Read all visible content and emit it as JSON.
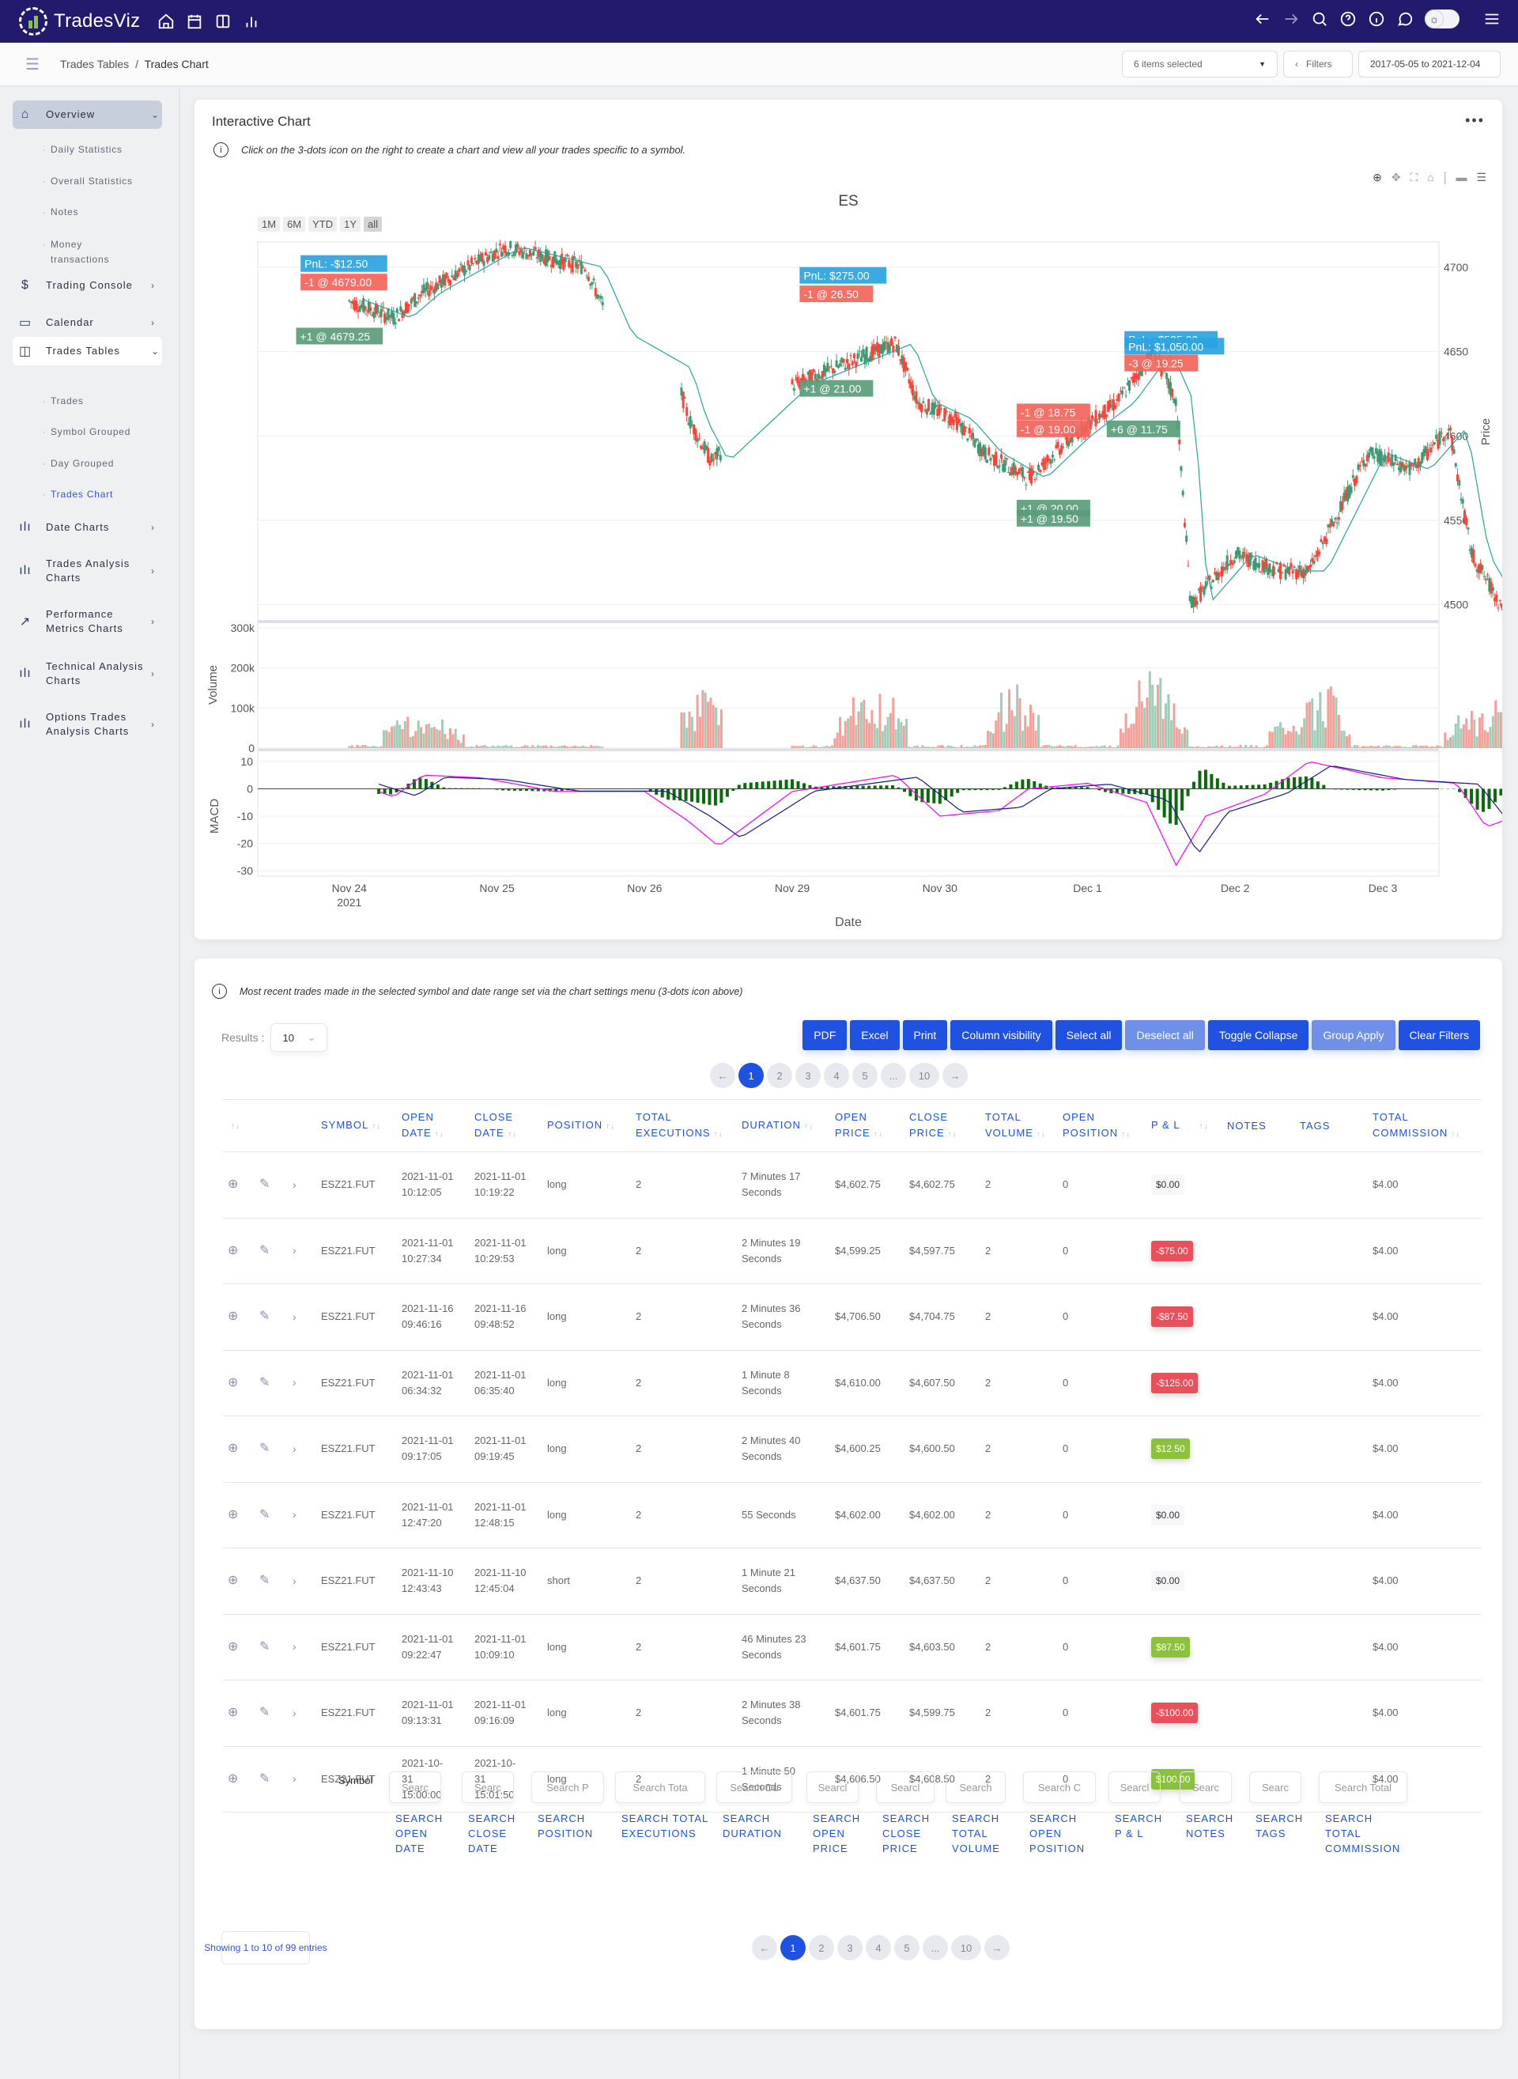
{
  "app": {
    "brand": "TradesViz"
  },
  "topbar": {
    "left_icons": [
      "home-icon",
      "calendar-icon",
      "columns-icon",
      "bar-chart-icon"
    ],
    "right_icons": [
      "back-arrow-icon",
      "forward-arrow-icon",
      "search-icon",
      "help-icon",
      "info-icon",
      "chat-icon"
    ],
    "theme_toggle": "sun-icon"
  },
  "subbar": {
    "breadcrumb_parent": "Trades Tables",
    "breadcrumb_sep": "/",
    "breadcrumb_current": "Trades Chart",
    "items_selected": "6 items selected",
    "filters": "Filters",
    "date_range": "2017-05-05 to 2021-12-04"
  },
  "sidebar": {
    "items": [
      {
        "label": "Overview",
        "icon": "home-icon"
      },
      {
        "label": "Trading Console",
        "icon": "dollar-icon"
      },
      {
        "label": "Calendar",
        "icon": "calendar-icon"
      },
      {
        "label": "Trades Tables",
        "icon": "columns-icon"
      },
      {
        "label": "Date Charts",
        "icon": "bar-chart-icon"
      },
      {
        "label": "Trades Analysis Charts",
        "icon": "bar-chart-icon"
      },
      {
        "label": "Performance Metrics Charts",
        "icon": "trend-icon"
      },
      {
        "label": "Technical Analysis Charts",
        "icon": "bar-chart-icon"
      },
      {
        "label": "Options Trades Analysis Charts",
        "icon": "bar-chart-icon"
      }
    ],
    "overview_sub": [
      "Daily Statistics",
      "Overall Statistics",
      "Notes",
      "Money transactions"
    ],
    "tables_sub": [
      "Trades",
      "Symbol Grouped",
      "Day Grouped",
      "Trades Chart"
    ]
  },
  "chart_card": {
    "title": "Interactive Chart",
    "info": "Click on the 3-dots icon on the right to create a chart and view all your trades specific to a symbol.",
    "range_buttons": [
      "1M",
      "6M",
      "YTD",
      "1Y",
      "all"
    ],
    "selected_range": "all",
    "modebar": [
      "zoom-icon",
      "pan-icon",
      "autoscale-icon",
      "reset-icon",
      "spike-icon",
      "hover-closest-icon",
      "hover-compare-icon"
    ]
  },
  "chart_data": {
    "type": "candlestick",
    "title": "ES",
    "xlabel": "Date",
    "x_ticks": [
      "Nov 24\n2021",
      "Nov 25",
      "Nov 26",
      "Nov 29",
      "Nov 30",
      "Dec 1",
      "Dec 2",
      "Dec 3"
    ],
    "price_panel": {
      "ylabel": "Price",
      "ylim": [
        4490,
        4715
      ],
      "y_ticks": [
        4500,
        4550,
        4600,
        4650,
        4700
      ],
      "trend_approx": [
        [
          0,
          4680
        ],
        [
          0.3,
          4670
        ],
        [
          0.5,
          4685
        ],
        [
          1.05,
          4712
        ],
        [
          1.6,
          4700
        ],
        [
          1.8,
          4660
        ],
        [
          2.2,
          4640
        ],
        [
          2.3,
          4610
        ],
        [
          2.45,
          4585
        ],
        [
          3.0,
          4630
        ],
        [
          3.7,
          4655
        ],
        [
          3.85,
          4620
        ],
        [
          4.1,
          4610
        ],
        [
          4.3,
          4590
        ],
        [
          4.6,
          4575
        ],
        [
          4.9,
          4600
        ],
        [
          5.2,
          4620
        ],
        [
          5.45,
          4650
        ],
        [
          5.6,
          4620
        ],
        [
          5.7,
          4500
        ],
        [
          6.0,
          4530
        ],
        [
          6.3,
          4520
        ],
        [
          6.5,
          4520
        ],
        [
          6.9,
          4590
        ],
        [
          7.2,
          4580
        ],
        [
          7.45,
          4605
        ],
        [
          7.6,
          4530
        ],
        [
          7.8,
          4500
        ],
        [
          8.0,
          4530
        ]
      ],
      "annotations": [
        {
          "label": "PnL: -$12.50",
          "kind": "pnl"
        },
        {
          "label": "-1 @ 4679.00",
          "kind": "sell"
        },
        {
          "label": "+1 @ 4679.25",
          "kind": "buy"
        },
        {
          "label": "PnL: $275.00",
          "kind": "pnl"
        },
        {
          "label": "-1 @ 26.50",
          "kind": "sell"
        },
        {
          "label": "+1 @ 21.00",
          "kind": "buy"
        },
        {
          "label": "PnL: -$525.00",
          "kind": "pnl"
        },
        {
          "label": "PnL: $1,050.00",
          "kind": "pnl"
        },
        {
          "label": "-3 @ 19.25",
          "kind": "sell"
        },
        {
          "label": "+6 @ 11.75",
          "kind": "buy"
        },
        {
          "label": "-1 @ 18.75",
          "kind": "sell"
        },
        {
          "label": "-1 @ 19.00",
          "kind": "sell"
        },
        {
          "label": "+1 @ 20.00",
          "kind": "buy"
        },
        {
          "label": "+1 @ 19.50",
          "kind": "buy"
        }
      ]
    },
    "volume_panel": {
      "ylabel": "Volume",
      "ylim": [
        0,
        300000
      ],
      "y_ticks": [
        "0",
        "100k",
        "200k",
        "300k"
      ],
      "spikes_approx": [
        [
          0.4,
          105000
        ],
        [
          0.6,
          87000
        ],
        [
          2.4,
          165000
        ],
        [
          3.45,
          145000
        ],
        [
          3.6,
          170000
        ],
        [
          4.5,
          190000
        ],
        [
          5.4,
          210000
        ],
        [
          5.5,
          200000
        ],
        [
          6.4,
          100000
        ],
        [
          6.6,
          180000
        ],
        [
          7.6,
          120000
        ],
        [
          7.85,
          175000
        ]
      ]
    },
    "macd_panel": {
      "ylabel": "MACD",
      "ylim": [
        -32,
        12
      ],
      "y_ticks": [
        10,
        0,
        -10,
        -20,
        -30
      ],
      "macd_approx": [
        [
          0.2,
          -1
        ],
        [
          0.3,
          -3
        ],
        [
          0.5,
          5
        ],
        [
          0.9,
          4
        ],
        [
          1.4,
          -1
        ],
        [
          2.0,
          -1
        ],
        [
          2.3,
          -12
        ],
        [
          2.5,
          -21
        ],
        [
          3.0,
          -1
        ],
        [
          3.7,
          5
        ],
        [
          4.0,
          -10
        ],
        [
          4.4,
          -8
        ],
        [
          4.6,
          0
        ],
        [
          5.0,
          2
        ],
        [
          5.4,
          -5
        ],
        [
          5.6,
          -28
        ],
        [
          5.8,
          -10
        ],
        [
          6.2,
          -2
        ],
        [
          6.5,
          10
        ],
        [
          7.0,
          4
        ],
        [
          7.5,
          2
        ],
        [
          7.7,
          -14
        ],
        [
          8.0,
          -8
        ]
      ]
    }
  },
  "trades_card": {
    "info": "Most recent trades made in the selected symbol and date range set via the chart settings menu (3-dots icon above)",
    "results_label": "Results :",
    "results_value": "10",
    "buttons": [
      {
        "label": "PDF",
        "dim": false
      },
      {
        "label": "Excel",
        "dim": false
      },
      {
        "label": "Print",
        "dim": false
      },
      {
        "label": "Column visibility",
        "dim": false
      },
      {
        "label": "Select all",
        "dim": false
      },
      {
        "label": "Deselect all",
        "dim": true
      },
      {
        "label": "Toggle Collapse",
        "dim": false
      },
      {
        "label": "Group Apply",
        "dim": true
      },
      {
        "label": "Clear Filters",
        "dim": false
      }
    ],
    "pages": [
      "←",
      "1",
      "2",
      "3",
      "4",
      "5",
      "...",
      "10",
      "→"
    ],
    "current_page": "1",
    "columns": [
      "SYMBOL",
      "OPEN DATE",
      "CLOSE DATE",
      "POSITION",
      "TOTAL EXECUTIONS",
      "DURATION",
      "OPEN PRICE",
      "CLOSE PRICE",
      "TOTAL VOLUME",
      "OPEN POSITION",
      "P & L",
      "NOTES",
      "TAGS",
      "TOTAL COMMISSION"
    ],
    "rows": [
      {
        "symbol": "ESZ21.FUT",
        "open": "2021-11-01 10:12:05",
        "close": "2021-11-01 10:19:22",
        "position": "long",
        "execs": "2",
        "duration": "7 Minutes 17 Seconds",
        "open_price": "$4,602.75",
        "close_price": "$4,602.75",
        "volume": "2",
        "open_pos": "0",
        "pnl": "$0.00",
        "pnl_kind": "zero",
        "notes": "",
        "tags": "",
        "commission": "$4.00"
      },
      {
        "symbol": "ESZ21.FUT",
        "open": "2021-11-01 10:27:34",
        "close": "2021-11-01 10:29:53",
        "position": "long",
        "execs": "2",
        "duration": "2 Minutes 19 Seconds",
        "open_price": "$4,599.25",
        "close_price": "$4,597.75",
        "volume": "2",
        "open_pos": "0",
        "pnl": "-$75.00",
        "pnl_kind": "neg",
        "notes": "",
        "tags": "",
        "commission": "$4.00"
      },
      {
        "symbol": "ESZ21.FUT",
        "open": "2021-11-16 09:46:16",
        "close": "2021-11-16 09:48:52",
        "position": "long",
        "execs": "2",
        "duration": "2 Minutes 36 Seconds",
        "open_price": "$4,706.50",
        "close_price": "$4,704.75",
        "volume": "2",
        "open_pos": "0",
        "pnl": "-$87.50",
        "pnl_kind": "neg",
        "notes": "",
        "tags": "",
        "commission": "$4.00"
      },
      {
        "symbol": "ESZ21.FUT",
        "open": "2021-11-01 06:34:32",
        "close": "2021-11-01 06:35:40",
        "position": "long",
        "execs": "2",
        "duration": "1 Minute 8 Seconds",
        "open_price": "$4,610.00",
        "close_price": "$4,607.50",
        "volume": "2",
        "open_pos": "0",
        "pnl": "-$125.00",
        "pnl_kind": "neg",
        "notes": "",
        "tags": "",
        "commission": "$4.00"
      },
      {
        "symbol": "ESZ21.FUT",
        "open": "2021-11-01 09:17:05",
        "close": "2021-11-01 09:19:45",
        "position": "long",
        "execs": "2",
        "duration": "2 Minutes 40 Seconds",
        "open_price": "$4,600.25",
        "close_price": "$4,600.50",
        "volume": "2",
        "open_pos": "0",
        "pnl": "$12.50",
        "pnl_kind": "pos",
        "notes": "",
        "tags": "",
        "commission": "$4.00"
      },
      {
        "symbol": "ESZ21.FUT",
        "open": "2021-11-01 12:47:20",
        "close": "2021-11-01 12:48:15",
        "position": "long",
        "execs": "2",
        "duration": "55 Seconds",
        "open_price": "$4,602.00",
        "close_price": "$4,602.00",
        "volume": "2",
        "open_pos": "0",
        "pnl": "$0.00",
        "pnl_kind": "zero",
        "notes": "",
        "tags": "",
        "commission": "$4.00"
      },
      {
        "symbol": "ESZ21.FUT",
        "open": "2021-11-10 12:43:43",
        "close": "2021-11-10 12:45:04",
        "position": "short",
        "execs": "2",
        "duration": "1 Minute 21 Seconds",
        "open_price": "$4,637.50",
        "close_price": "$4,637.50",
        "volume": "2",
        "open_pos": "0",
        "pnl": "$0.00",
        "pnl_kind": "zero",
        "notes": "",
        "tags": "",
        "commission": "$4.00"
      },
      {
        "symbol": "ESZ21.FUT",
        "open": "2021-11-01 09:22:47",
        "close": "2021-11-01 10:09:10",
        "position": "long",
        "execs": "2",
        "duration": "46 Minutes 23 Seconds",
        "open_price": "$4,601.75",
        "close_price": "$4,603.50",
        "volume": "2",
        "open_pos": "0",
        "pnl": "$87.50",
        "pnl_kind": "pos",
        "notes": "",
        "tags": "",
        "commission": "$4.00"
      },
      {
        "symbol": "ESZ21.FUT",
        "open": "2021-11-01 09:13:31",
        "close": "2021-11-01 09:16:09",
        "position": "long",
        "execs": "2",
        "duration": "2 Minutes 38 Seconds",
        "open_price": "$4,601.75",
        "close_price": "$4,599.75",
        "volume": "2",
        "open_pos": "0",
        "pnl": "-$100.00",
        "pnl_kind": "neg",
        "notes": "",
        "tags": "",
        "commission": "$4.00"
      },
      {
        "symbol": "ESZ21.FUT",
        "open": "2021-10-31 15:00:00",
        "close": "2021-10-31 15:01:50",
        "position": "long",
        "execs": "2",
        "duration": "1 Minute 50 Seconds",
        "open_price": "$4,606.50",
        "close_price": "$4,608.50",
        "volume": "2",
        "open_pos": "0",
        "pnl": "$100.00",
        "pnl_kind": "pos",
        "notes": "",
        "tags": "",
        "commission": "$4.00"
      }
    ],
    "footer_symbol_label": "Symbol",
    "search_fields": [
      {
        "placeholder": "Searc",
        "label": "SEARCH OPEN DATE"
      },
      {
        "placeholder": "Searc",
        "label": "SEARCH CLOSE DATE"
      },
      {
        "placeholder": "Search P",
        "label": "SEARCH POSITION"
      },
      {
        "placeholder": "Search Tota",
        "label": "SEARCH TOTAL EXECUTIONS"
      },
      {
        "placeholder": "Search Du",
        "label": "SEARCH DURATION"
      },
      {
        "placeholder": "Searcl",
        "label": "SEARCH OPEN PRICE"
      },
      {
        "placeholder": "Searcl",
        "label": "SEARCH CLOSE PRICE"
      },
      {
        "placeholder": "Search",
        "label": "SEARCH TOTAL VOLUME"
      },
      {
        "placeholder": "Search C",
        "label": "SEARCH OPEN POSITION"
      },
      {
        "placeholder": "Searcl",
        "label": "SEARCH P & L"
      },
      {
        "placeholder": "Searc",
        "label": "SEARCH NOTES"
      },
      {
        "placeholder": "Searc",
        "label": "SEARCH TAGS"
      },
      {
        "placeholder": "Search Total",
        "label": "SEARCH TOTAL COMMISSION"
      }
    ],
    "showing": "Showing 1 to 10 of 99 entries"
  },
  "colors": {
    "nav_bg": "#221a6c",
    "primary": "#1f52e0",
    "up": "#3d9970",
    "down": "#ff4136",
    "pnl_label": "#29a3e0",
    "buy_label": "#5a9c7a",
    "sell_label": "#f2645a",
    "loss_badge": "#e8505b",
    "gain_badge": "#8bc13c"
  }
}
